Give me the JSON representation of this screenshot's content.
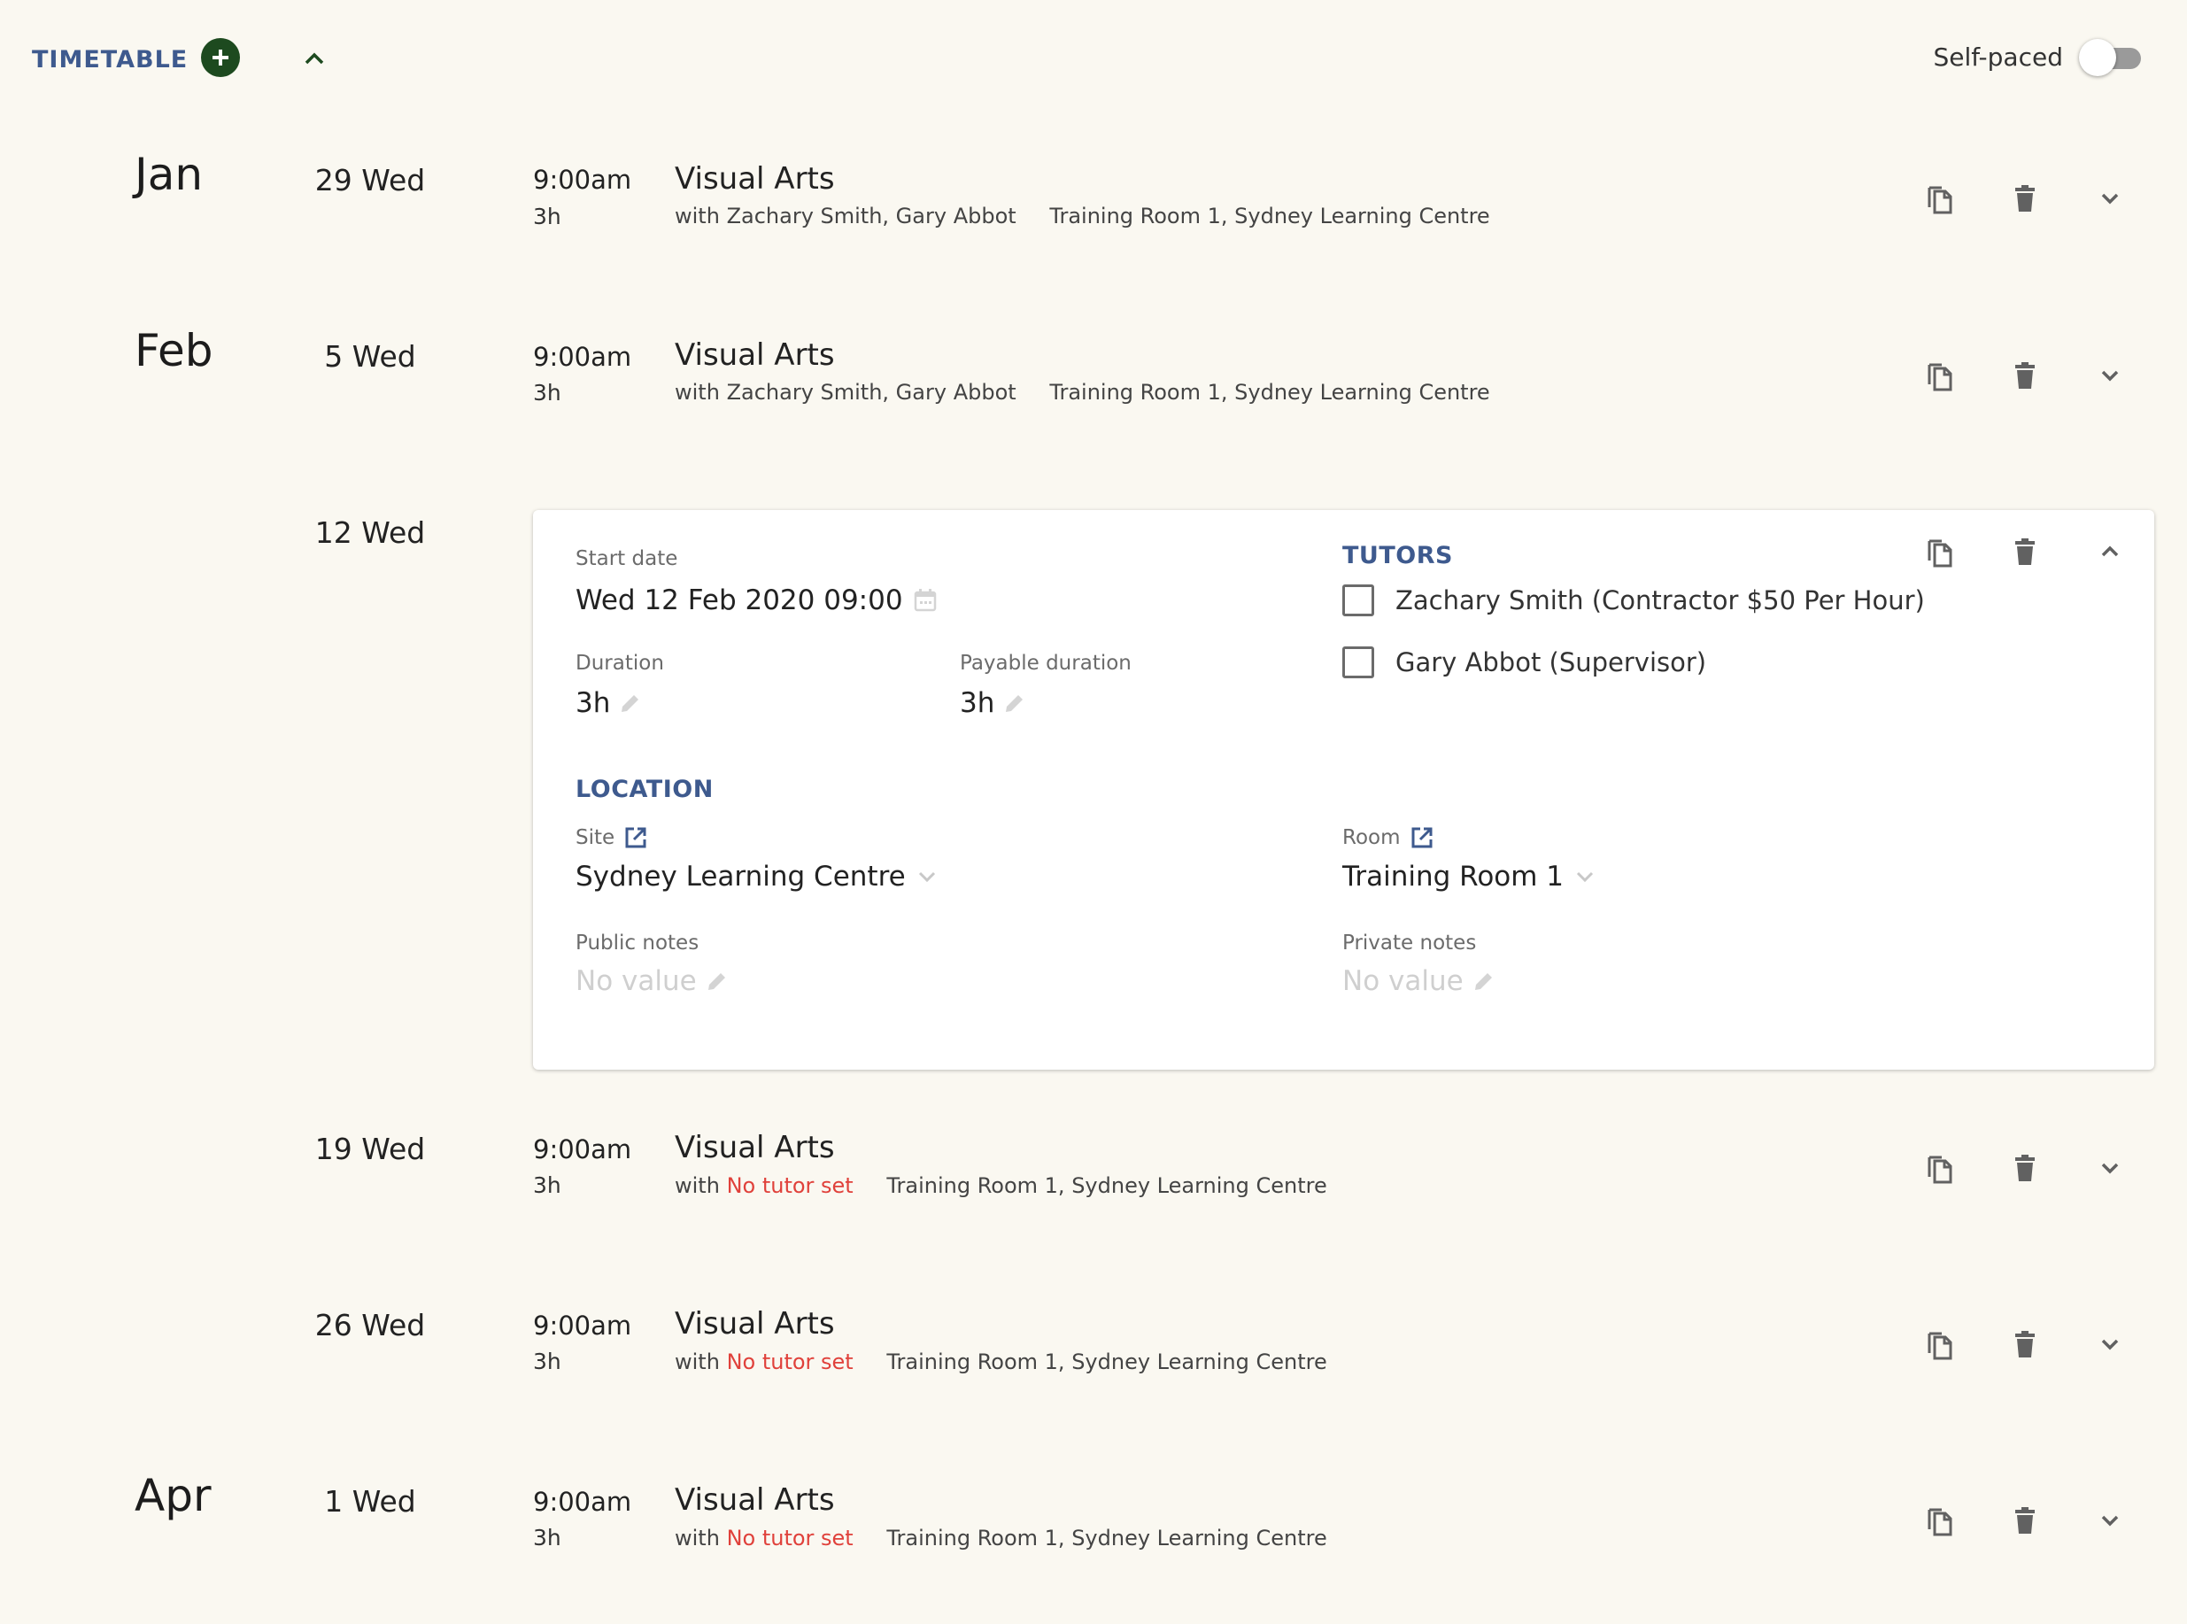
{
  "header": {
    "title": "TIMETABLE",
    "self_paced_label": "Self-paced",
    "self_paced_on": false
  },
  "colors": {
    "accent": "#3e5a8e",
    "add_button": "#1d4a1f",
    "no_tutor": "#e0413b",
    "background": "#faf8f1",
    "icon": "#616161"
  },
  "sessions": [
    {
      "month": "Jan",
      "day": "29 Wed",
      "time": "9:00am",
      "duration": "3h",
      "title": "Visual Arts",
      "with": "with",
      "tutors": "Zachary Smith, Gary Abbot",
      "location": "Training Room 1, Sydney Learning Centre"
    },
    {
      "month": "Feb",
      "day": "5 Wed",
      "time": "9:00am",
      "duration": "3h",
      "title": "Visual Arts",
      "with": "with",
      "tutors": "Zachary Smith, Gary Abbot",
      "location": "Training Room 1, Sydney Learning Centre"
    },
    {
      "month": "",
      "day": "12 Wed",
      "expanded": true
    },
    {
      "month": "",
      "day": "19 Wed",
      "time": "9:00am",
      "duration": "3h",
      "title": "Visual Arts",
      "with": "with",
      "tutors": "No tutor set",
      "location": "Training Room 1, Sydney Learning Centre"
    },
    {
      "month": "",
      "day": "26 Wed",
      "time": "9:00am",
      "duration": "3h",
      "title": "Visual Arts",
      "with": "with",
      "tutors": "No tutor set",
      "location": "Training Room 1, Sydney Learning Centre"
    },
    {
      "month": "Apr",
      "day": "1 Wed",
      "time": "9:00am",
      "duration": "3h",
      "title": "Visual Arts",
      "with": "with",
      "tutors": "No tutor set",
      "location": "Training Room 1, Sydney Learning Centre"
    }
  ],
  "expanded_session": {
    "start_date_label": "Start date",
    "start_date_value": "Wed 12 Feb 2020 09:00",
    "duration_label": "Duration",
    "duration_value": "3h",
    "payable_duration_label": "Payable duration",
    "payable_duration_value": "3h",
    "tutors_heading": "TUTORS",
    "tutors": [
      {
        "label": "Zachary Smith (Contractor $50 Per Hour)",
        "checked": false
      },
      {
        "label": "Gary Abbot (Supervisor)",
        "checked": false
      }
    ],
    "location_heading": "LOCATION",
    "site_label": "Site",
    "site_value": "Sydney Learning Centre",
    "room_label": "Room",
    "room_value": "Training Room 1",
    "public_notes_label": "Public notes",
    "public_notes_value": "No value",
    "private_notes_label": "Private notes",
    "private_notes_value": "No value"
  },
  "icons": [
    "add-icon",
    "chevron-up-icon",
    "copy-icon",
    "delete-icon",
    "chevron-down-icon",
    "calendar-icon",
    "edit-icon",
    "open-external-icon"
  ]
}
